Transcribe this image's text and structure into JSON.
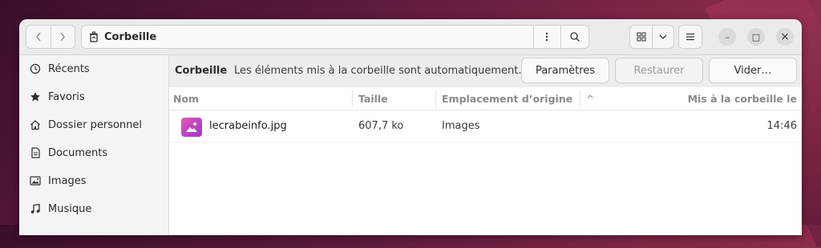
{
  "window": {
    "title": "Corbeille"
  },
  "toolbar": {
    "back_icon": "chevron-left",
    "forward_icon": "chevron-right",
    "location_label": "Corbeille",
    "location_icon": "trash-icon",
    "menu_icon": "vertical-dots",
    "search_icon": "magnifier",
    "view_icon": "grid",
    "view_menu_icon": "chevron-down",
    "main_menu_icon": "hamburger"
  },
  "window_controls": {
    "minimize": "–",
    "maximize": "□",
    "close": "×"
  },
  "sidebar": {
    "items": [
      {
        "label": "Récents",
        "icon": "clock-icon"
      },
      {
        "label": "Favoris",
        "icon": "star-icon"
      },
      {
        "label": "Dossier personnel",
        "icon": "home-icon"
      },
      {
        "label": "Documents",
        "icon": "document-icon"
      },
      {
        "label": "Images",
        "icon": "image-icon"
      },
      {
        "label": "Musique",
        "icon": "music-icon"
      }
    ]
  },
  "infobar": {
    "title": "Corbeille",
    "message": "Les éléments mis à la corbeille sont automatiquement…",
    "settings_label": "Paramètres",
    "restore_label": "Restaurer",
    "empty_label": "Vider…"
  },
  "columns": {
    "name": "Nom",
    "size": "Taille",
    "origin": "Emplacement d’origine",
    "sort_icon": "^",
    "trashed": "Mis à la corbeille le"
  },
  "files": [
    {
      "name": "lecrabeinfo.jpg",
      "size": "607,7 ko",
      "origin": "Images",
      "trashed": "14:46",
      "icon": "image-file-icon"
    }
  ],
  "colors": {
    "accent_thumb": "#c94dc1",
    "headerbar": "#ebebeb",
    "sidebar": "#f4f4f4"
  }
}
